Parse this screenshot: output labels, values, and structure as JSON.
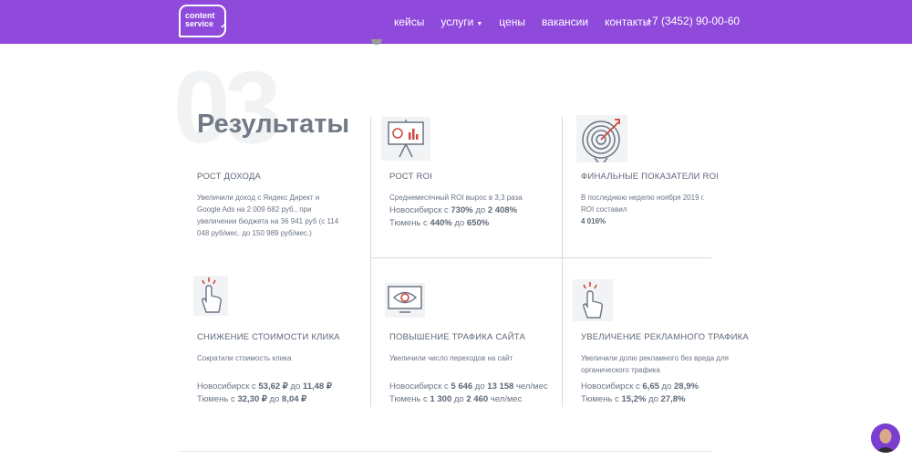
{
  "header": {
    "logo_line1": "content",
    "logo_line2": "service",
    "nav": [
      "кейсы",
      "услуги",
      "цены",
      "вакансии",
      "контакты"
    ],
    "phone": "+7 (3452) 90-00-60"
  },
  "section": {
    "number": "03",
    "title": "Результаты"
  },
  "cards": [
    {
      "title": "Рост дохода",
      "text": "Увеличили доход с Яндекс Директ и Google Ads на 2 009 682 руб., при увеличении бюджета на 36 941 руб (с 114 048 руб/мес. до 150 989 руб/мес.)"
    },
    {
      "title": "Рост ROI",
      "text": "Среднемесячный ROI вырос в 3,3 раза",
      "m1_pre": "Новосибирск с ",
      "m1_a": "730%",
      "m1_mid": " до ",
      "m1_b": "2 408%",
      "m2_pre": "Тюмень с ",
      "m2_a": "440%",
      "m2_mid": " до ",
      "m2_b": "650%"
    },
    {
      "title": "Финальные показатели ROI",
      "text": "В последнюю неделю ноября 2019 г. ROI составил",
      "value": "4 016%"
    },
    {
      "title": "Снижение стоимости клика",
      "text": "Сократили стоимость клика",
      "m1_pre": "Новосибирск с ",
      "m1_a": "53,62 ₽",
      "m1_mid": " до ",
      "m1_b": "11,48 ₽",
      "m2_pre": "Тюмень с ",
      "m2_a": "32,30 ₽",
      "m2_mid": " до ",
      "m2_b": "8,04 ₽"
    },
    {
      "title": "Повышение трафика сайта",
      "text": "Увеличили число переходов на сайт",
      "m1_pre": "Новосибирск с ",
      "m1_a": "5 646",
      "m1_mid": " до ",
      "m1_b": "13 158",
      "m1_post": " чел/мес",
      "m2_pre": "Тюмень с ",
      "m2_a": "1 300",
      "m2_mid": " до ",
      "m2_b": "2 460",
      "m2_post": " чел/мес"
    },
    {
      "title": "Увеличение рекламного трафика",
      "text": "Увеличили долю рекламного без вреда для органического трафика",
      "m1_pre": "Новосибирск с ",
      "m1_a": "6,65",
      "m1_mid": " до ",
      "m1_b": "28,9%",
      "m2_pre": "Тюмень с ",
      "m2_a": "15,2%",
      "m2_mid": " до ",
      "m2_b": "27,8%"
    }
  ],
  "colors": {
    "header_bg": "#8f49db",
    "accent_red": "#d0453c",
    "text": "#5d6877"
  }
}
